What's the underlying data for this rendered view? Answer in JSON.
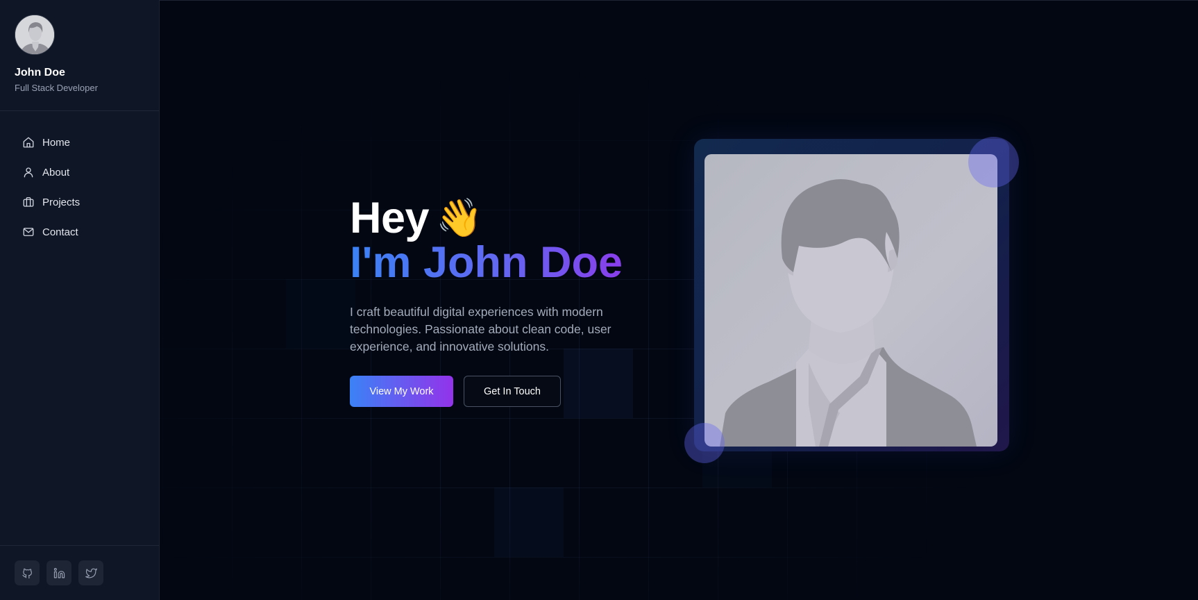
{
  "sidebar": {
    "profile": {
      "name": "John Doe",
      "role": "Full Stack Developer",
      "avatar_icon": "person-silhouette-icon"
    },
    "nav": [
      {
        "label": "Home",
        "icon": "home-icon"
      },
      {
        "label": "About",
        "icon": "user-icon"
      },
      {
        "label": "Projects",
        "icon": "briefcase-icon"
      },
      {
        "label": "Contact",
        "icon": "mail-icon"
      }
    ],
    "socials": [
      {
        "icon": "github-icon"
      },
      {
        "icon": "linkedin-icon"
      },
      {
        "icon": "twitter-icon"
      }
    ]
  },
  "hero": {
    "greeting": "Hey",
    "wave_emoji": "👋",
    "headline": "I'm John Doe",
    "description": "I craft beautiful digital experiences with modern technologies. Passionate about clean code, user experience, and innovative solutions.",
    "primary_button": "View My Work",
    "secondary_button": "Get In Touch",
    "photo_icon": "person-silhouette-icon"
  },
  "colors": {
    "background": "#020712",
    "sidebar": "#0f1626",
    "accent_start": "#3b82f6",
    "accent_end": "#9333ea"
  }
}
